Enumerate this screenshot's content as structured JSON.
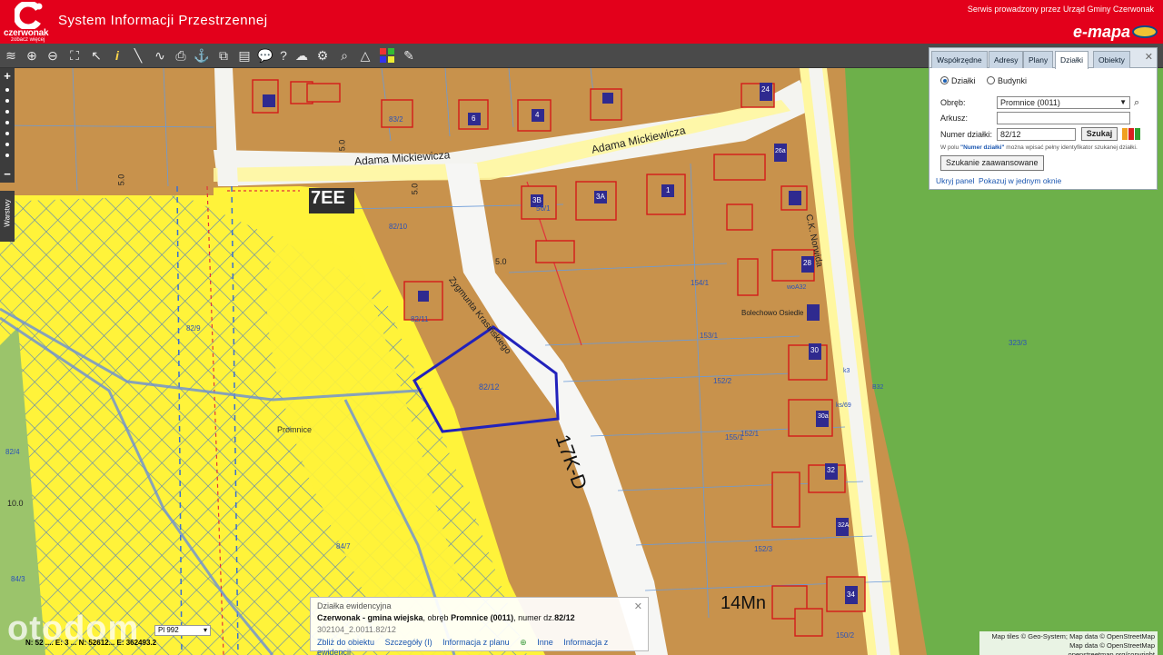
{
  "header": {
    "logo_name": "czerwonak",
    "logo_slogan": "zobacz więcej",
    "app_title": "System Informacji Przestrzennej",
    "service_text": "Serwis prowadzony przez Urząd  Gminy Czerwonak",
    "brand": "e-mapa"
  },
  "toolbar": {
    "tools": [
      "layers-icon",
      "zoom-in-icon",
      "zoom-out-icon",
      "zoom-extent-icon",
      "select-icon",
      "info-icon",
      "measure-length-icon",
      "measure-area-icon",
      "print-icon",
      "anchor-icon",
      "copy-icon",
      "layout-icon",
      "comment-icon",
      "help-icon",
      "cloud-upload-icon",
      "settings-icon",
      "search-icon",
      "triangle-icon",
      "grid-icon",
      "sticker-icon"
    ]
  },
  "left_tools": {
    "zoom_in": "+",
    "zoom_out": "−",
    "layers_tab": "Warstwy"
  },
  "panel": {
    "tabs": [
      "Współrzędne",
      "Adresy",
      "Plany",
      "Działki",
      "Obiekty"
    ],
    "active_tab": "Działki",
    "radio_parcels": "Działki",
    "radio_buildings": "Budynki",
    "obreb_label": "Obręb:",
    "obreb_value": "Promnice (0011)",
    "arkusz_label": "Arkusz:",
    "arkusz_value": "",
    "numer_label": "Numer działki:",
    "numer_value": "82/12",
    "search_button": "Szukaj",
    "hint_prefix": "W polu ",
    "hint_field": "\"Numer działki\"",
    "hint_suffix": " można wpisać pełny identyfikator szukanej działki.",
    "advanced_button": "Szukanie zaawansowane",
    "hide_panel": "Ukryj panel",
    "show_window": "Pokazuj w jednym oknie"
  },
  "map_labels": {
    "street_main": "Adama Mickiewicza",
    "street_vertical": "Adama Mickiewicza",
    "street_diagonal": "Zygmunta Krasińskiego",
    "street_norwida": "C.K. Norwida",
    "street_bolechowo": "Bolechowo Osiedle",
    "road_code_1": "17K-D",
    "road_code_2": "7EE",
    "road_code_3": "14Mn",
    "settlement": "Promnice",
    "parcel_selected": "82/12",
    "parcel_labels": [
      "82/10",
      "82/11",
      "82/9",
      "82/4",
      "84/7",
      "83/2",
      "84/3",
      "152/1",
      "152/2",
      "152/3",
      "150/2",
      "153/1",
      "155/1",
      "323/3",
      "154/1",
      "56/1"
    ],
    "contour_values": [
      "5.0",
      "5.0",
      "5.0",
      "5.0",
      "10.0"
    ],
    "symbols": [
      "woA32",
      "ks/69",
      "B32",
      "k3"
    ],
    "building_numbers": [
      "6",
      "4",
      "1",
      "3B",
      "3A",
      "24",
      "26a",
      "28",
      "30",
      "30a",
      "32",
      "32A",
      "34"
    ]
  },
  "popup": {
    "title": "Działka ewidencyjna",
    "desc_gmina": "Czerwonak - gmina wiejska",
    "desc_mid": ", obręb ",
    "desc_obreb": "Promnice (0011)",
    "desc_mid2": ", numer dz.",
    "desc_num": "82/12",
    "parcel_id": "302104_2.0011.82/12",
    "links": [
      "Zbliż do obiektu",
      "Szczegóły (I)",
      "Informacja z planu",
      "Inne",
      "Informacja z ewidencji"
    ]
  },
  "coords": {
    "scale_label": "Pl 992",
    "coord_text": "N: 52 .... E: 3 ... N: 52612... E: 362493.2"
  },
  "attribution": {
    "line1": "Map tiles © Geo-System; Map data © OpenStreetMap",
    "line2": "Map data © OpenStreetMap ...openstreetmap.org/copyright"
  },
  "watermark": "otodom",
  "colors": {
    "header_red": "#e3001b",
    "plot_brown": "#c8924c",
    "yellow_zone": "#fff33a",
    "green_field": "#6db04a",
    "parcel_highlight": "#2222bb"
  }
}
